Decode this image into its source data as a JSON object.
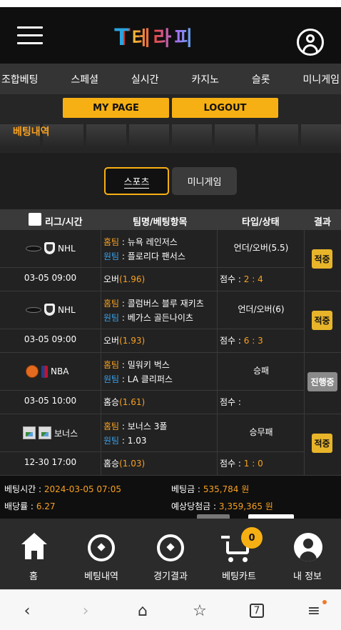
{
  "header": {
    "logo_mark": "T",
    "logo_text": "테라피"
  },
  "nav": [
    "조합베팅",
    "스페셜",
    "실시간",
    "카지노",
    "슬롯",
    "미니게임"
  ],
  "buttons": {
    "my_page": "MY PAGE",
    "logout": "LOGOUT"
  },
  "section_title": "베팅내역",
  "tabs": {
    "sports": "스포츠",
    "mini": "미니게임"
  },
  "table_header": {
    "league_time": "리그/시간",
    "teams": "팀명/베팅항목",
    "type_status": "타입/상태",
    "result": "결과"
  },
  "home_label": "홈팀",
  "away_label": "원팀",
  "score_label": "점수 :",
  "bets": [
    {
      "league": "NHL",
      "sport_icon": "hockey-puck-icon",
      "home": "뉴욕 레인저스",
      "away": "플로리다 팬서스",
      "type": "언더/오버(5.5)",
      "time": "03-05 09:00",
      "pick": "오버",
      "odds": "(1.96)",
      "score": "2 : 4",
      "result": "적중"
    },
    {
      "league": "NHL",
      "sport_icon": "hockey-puck-icon",
      "home": "콜럼버스 블루 재키츠",
      "away": "베가스 골든나이츠",
      "type": "언더/오버(6)",
      "time": "03-05 09:00",
      "pick": "오버",
      "odds": "(1.93)",
      "score": "6 : 3",
      "result": "적중"
    },
    {
      "league": "NBA",
      "sport_icon": "basketball-icon",
      "home": "밀워키 벅스",
      "away": "LA 클리퍼스",
      "type": "승패",
      "time": "03-05 10:00",
      "pick": "홈승",
      "odds": "(1.61)",
      "score": "",
      "result": "진행중"
    },
    {
      "league": "보너스",
      "sport_icon": "broken-image-icon",
      "home": "보너스 3폴",
      "away": "1.03",
      "type": "승무패",
      "time": "12-30 17:00",
      "pick": "홈승",
      "odds": "(1.03)",
      "score": "1 : 0",
      "result": "적중"
    }
  ],
  "summary": {
    "bet_time_label": "베팅시간 :",
    "bet_time": "2024-03-05 07:05",
    "bet_amount_label": "베팅금 :",
    "bet_amount": "535,784 원",
    "odds_label": "배당률 :",
    "odds": "6.27",
    "expected_label": "예상당첨금 :",
    "expected": "3,359,365 원"
  },
  "bottom_nav": {
    "home": "홈",
    "bet_history": "베팅내역",
    "results": "경기결과",
    "cart": "베팅카트",
    "cart_count": "0",
    "my_info": "내 정보"
  },
  "browser": {
    "tabs_count": "7"
  },
  "colors": {
    "accent": "#f7b013",
    "home_team": "#f7a021",
    "away_team": "#3aa0e8"
  }
}
